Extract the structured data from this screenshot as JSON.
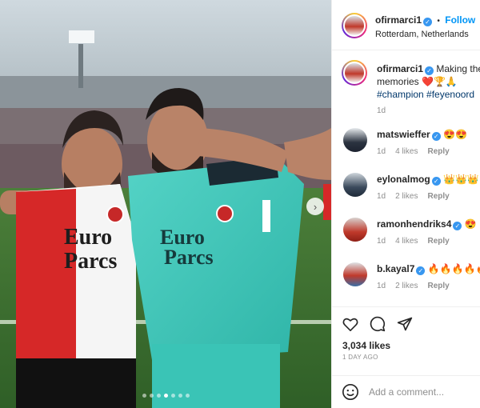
{
  "post": {
    "carousel_dot_count": 7,
    "carousel_active_index": 3,
    "next_icon": "chevron-right-icon"
  },
  "header": {
    "username": "ofirmarci1",
    "bullet": "•",
    "follow_label": "Follow",
    "location": "Rotterdam, Netherlands"
  },
  "caption": {
    "username": "ofirmarci1",
    "text_line1": "Making the",
    "text_line2": "memories ❤️🏆🙏",
    "hashtags": "#champion #feyenoord",
    "time": "1d"
  },
  "comments": [
    {
      "username": "matswieffer",
      "text": "😍😍",
      "time": "1d",
      "likes": "4 likes",
      "reply": "Reply"
    },
    {
      "username": "eylonalmog",
      "text": "👑👑👑",
      "time": "1d",
      "likes": "2 likes",
      "reply": "Reply"
    },
    {
      "username": "ramonhendriks4",
      "text": "😍",
      "time": "1d",
      "likes": "4 likes",
      "reply": "Reply"
    },
    {
      "username": "b.kayal7",
      "text": "🔥🔥🔥🔥🔥🔥",
      "time": "1d",
      "likes": "2 likes",
      "reply": "Reply"
    }
  ],
  "actions": {
    "like_icon": "heart-icon",
    "comment_icon": "comment-icon",
    "share_icon": "share-icon",
    "likes_count": "3,034 likes",
    "posted_ago": "1 DAY AGO"
  },
  "add_comment": {
    "placeholder": "Add a comment...",
    "emoji_icon": "emoji-smile-icon"
  },
  "colors": {
    "accent_blue": "#0095f6",
    "hashtag": "#00376b",
    "muted": "#8e8e8e",
    "verified": "#3897f0",
    "heart_red": "#e53935"
  }
}
